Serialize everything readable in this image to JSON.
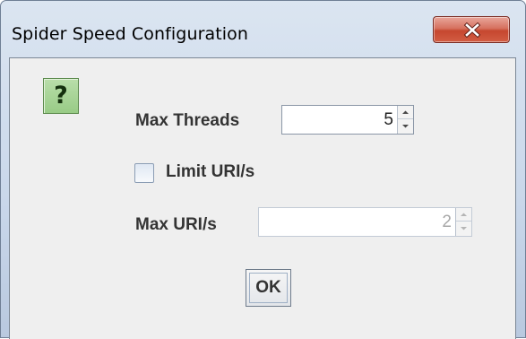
{
  "window": {
    "title": "Spider Speed Configuration"
  },
  "icons": {
    "help": "?",
    "close": "close-icon"
  },
  "form": {
    "max_threads": {
      "label": "Max Threads",
      "value": "5",
      "enabled": true
    },
    "limit_uris": {
      "label": "Limit URI/s",
      "checked": false
    },
    "max_uris": {
      "label": "Max URI/s",
      "value": "2",
      "enabled": false
    }
  },
  "buttons": {
    "ok": "OK"
  },
  "colors": {
    "close_button": "#c6472f",
    "help_icon_bg": "#98cb86",
    "dialog_bg": "#efefef"
  }
}
